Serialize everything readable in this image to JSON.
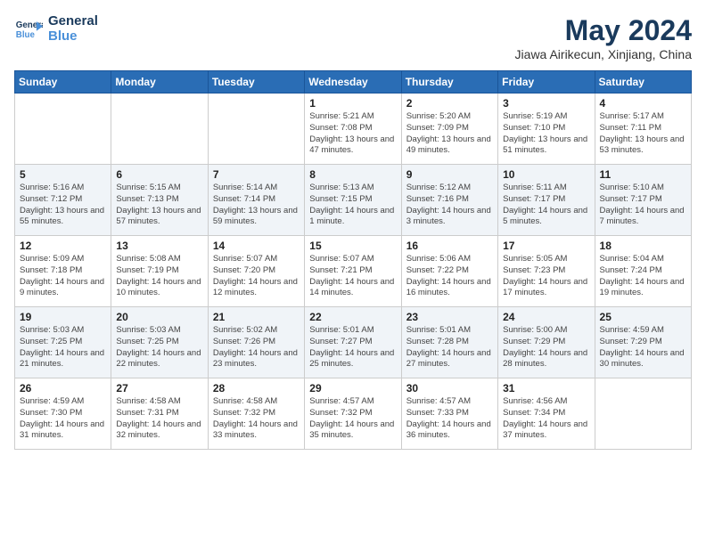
{
  "header": {
    "logo_line1": "General",
    "logo_line2": "Blue",
    "month_title": "May 2024",
    "location": "Jiawa Airikecun, Xinjiang, China"
  },
  "weekdays": [
    "Sunday",
    "Monday",
    "Tuesday",
    "Wednesday",
    "Thursday",
    "Friday",
    "Saturday"
  ],
  "weeks": [
    [
      {
        "day": "",
        "info": ""
      },
      {
        "day": "",
        "info": ""
      },
      {
        "day": "",
        "info": ""
      },
      {
        "day": "1",
        "info": "Sunrise: 5:21 AM\nSunset: 7:08 PM\nDaylight: 13 hours and 47 minutes."
      },
      {
        "day": "2",
        "info": "Sunrise: 5:20 AM\nSunset: 7:09 PM\nDaylight: 13 hours and 49 minutes."
      },
      {
        "day": "3",
        "info": "Sunrise: 5:19 AM\nSunset: 7:10 PM\nDaylight: 13 hours and 51 minutes."
      },
      {
        "day": "4",
        "info": "Sunrise: 5:17 AM\nSunset: 7:11 PM\nDaylight: 13 hours and 53 minutes."
      }
    ],
    [
      {
        "day": "5",
        "info": "Sunrise: 5:16 AM\nSunset: 7:12 PM\nDaylight: 13 hours and 55 minutes."
      },
      {
        "day": "6",
        "info": "Sunrise: 5:15 AM\nSunset: 7:13 PM\nDaylight: 13 hours and 57 minutes."
      },
      {
        "day": "7",
        "info": "Sunrise: 5:14 AM\nSunset: 7:14 PM\nDaylight: 13 hours and 59 minutes."
      },
      {
        "day": "8",
        "info": "Sunrise: 5:13 AM\nSunset: 7:15 PM\nDaylight: 14 hours and 1 minute."
      },
      {
        "day": "9",
        "info": "Sunrise: 5:12 AM\nSunset: 7:16 PM\nDaylight: 14 hours and 3 minutes."
      },
      {
        "day": "10",
        "info": "Sunrise: 5:11 AM\nSunset: 7:17 PM\nDaylight: 14 hours and 5 minutes."
      },
      {
        "day": "11",
        "info": "Sunrise: 5:10 AM\nSunset: 7:17 PM\nDaylight: 14 hours and 7 minutes."
      }
    ],
    [
      {
        "day": "12",
        "info": "Sunrise: 5:09 AM\nSunset: 7:18 PM\nDaylight: 14 hours and 9 minutes."
      },
      {
        "day": "13",
        "info": "Sunrise: 5:08 AM\nSunset: 7:19 PM\nDaylight: 14 hours and 10 minutes."
      },
      {
        "day": "14",
        "info": "Sunrise: 5:07 AM\nSunset: 7:20 PM\nDaylight: 14 hours and 12 minutes."
      },
      {
        "day": "15",
        "info": "Sunrise: 5:07 AM\nSunset: 7:21 PM\nDaylight: 14 hours and 14 minutes."
      },
      {
        "day": "16",
        "info": "Sunrise: 5:06 AM\nSunset: 7:22 PM\nDaylight: 14 hours and 16 minutes."
      },
      {
        "day": "17",
        "info": "Sunrise: 5:05 AM\nSunset: 7:23 PM\nDaylight: 14 hours and 17 minutes."
      },
      {
        "day": "18",
        "info": "Sunrise: 5:04 AM\nSunset: 7:24 PM\nDaylight: 14 hours and 19 minutes."
      }
    ],
    [
      {
        "day": "19",
        "info": "Sunrise: 5:03 AM\nSunset: 7:25 PM\nDaylight: 14 hours and 21 minutes."
      },
      {
        "day": "20",
        "info": "Sunrise: 5:03 AM\nSunset: 7:25 PM\nDaylight: 14 hours and 22 minutes."
      },
      {
        "day": "21",
        "info": "Sunrise: 5:02 AM\nSunset: 7:26 PM\nDaylight: 14 hours and 23 minutes."
      },
      {
        "day": "22",
        "info": "Sunrise: 5:01 AM\nSunset: 7:27 PM\nDaylight: 14 hours and 25 minutes."
      },
      {
        "day": "23",
        "info": "Sunrise: 5:01 AM\nSunset: 7:28 PM\nDaylight: 14 hours and 27 minutes."
      },
      {
        "day": "24",
        "info": "Sunrise: 5:00 AM\nSunset: 7:29 PM\nDaylight: 14 hours and 28 minutes."
      },
      {
        "day": "25",
        "info": "Sunrise: 4:59 AM\nSunset: 7:29 PM\nDaylight: 14 hours and 30 minutes."
      }
    ],
    [
      {
        "day": "26",
        "info": "Sunrise: 4:59 AM\nSunset: 7:30 PM\nDaylight: 14 hours and 31 minutes."
      },
      {
        "day": "27",
        "info": "Sunrise: 4:58 AM\nSunset: 7:31 PM\nDaylight: 14 hours and 32 minutes."
      },
      {
        "day": "28",
        "info": "Sunrise: 4:58 AM\nSunset: 7:32 PM\nDaylight: 14 hours and 33 minutes."
      },
      {
        "day": "29",
        "info": "Sunrise: 4:57 AM\nSunset: 7:32 PM\nDaylight: 14 hours and 35 minutes."
      },
      {
        "day": "30",
        "info": "Sunrise: 4:57 AM\nSunset: 7:33 PM\nDaylight: 14 hours and 36 minutes."
      },
      {
        "day": "31",
        "info": "Sunrise: 4:56 AM\nSunset: 7:34 PM\nDaylight: 14 hours and 37 minutes."
      },
      {
        "day": "",
        "info": ""
      }
    ]
  ]
}
